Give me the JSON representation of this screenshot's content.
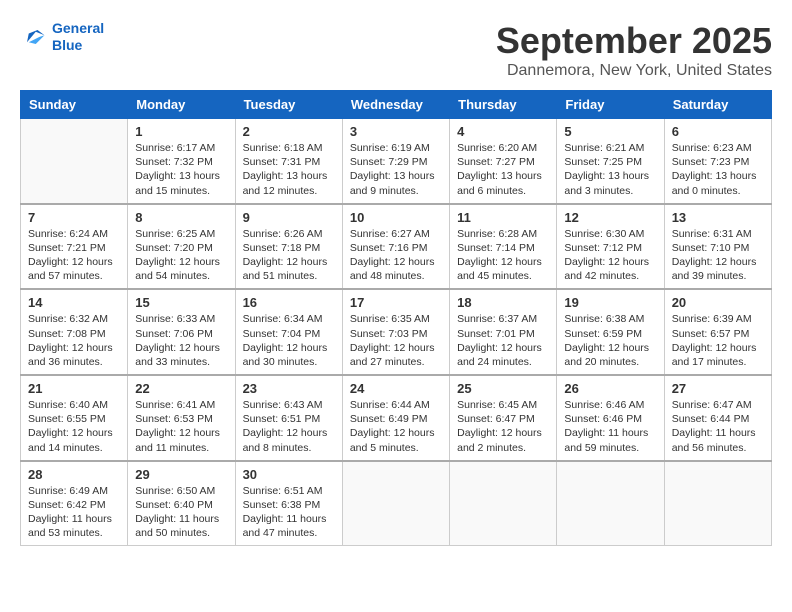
{
  "header": {
    "logo_line1": "General",
    "logo_line2": "Blue",
    "month": "September 2025",
    "location": "Dannemora, New York, United States"
  },
  "weekdays": [
    "Sunday",
    "Monday",
    "Tuesday",
    "Wednesday",
    "Thursday",
    "Friday",
    "Saturday"
  ],
  "weeks": [
    [
      {
        "day": "",
        "lines": []
      },
      {
        "day": "1",
        "lines": [
          "Sunrise: 6:17 AM",
          "Sunset: 7:32 PM",
          "Daylight: 13 hours",
          "and 15 minutes."
        ]
      },
      {
        "day": "2",
        "lines": [
          "Sunrise: 6:18 AM",
          "Sunset: 7:31 PM",
          "Daylight: 13 hours",
          "and 12 minutes."
        ]
      },
      {
        "day": "3",
        "lines": [
          "Sunrise: 6:19 AM",
          "Sunset: 7:29 PM",
          "Daylight: 13 hours",
          "and 9 minutes."
        ]
      },
      {
        "day": "4",
        "lines": [
          "Sunrise: 6:20 AM",
          "Sunset: 7:27 PM",
          "Daylight: 13 hours",
          "and 6 minutes."
        ]
      },
      {
        "day": "5",
        "lines": [
          "Sunrise: 6:21 AM",
          "Sunset: 7:25 PM",
          "Daylight: 13 hours",
          "and 3 minutes."
        ]
      },
      {
        "day": "6",
        "lines": [
          "Sunrise: 6:23 AM",
          "Sunset: 7:23 PM",
          "Daylight: 13 hours",
          "and 0 minutes."
        ]
      }
    ],
    [
      {
        "day": "7",
        "lines": [
          "Sunrise: 6:24 AM",
          "Sunset: 7:21 PM",
          "Daylight: 12 hours",
          "and 57 minutes."
        ]
      },
      {
        "day": "8",
        "lines": [
          "Sunrise: 6:25 AM",
          "Sunset: 7:20 PM",
          "Daylight: 12 hours",
          "and 54 minutes."
        ]
      },
      {
        "day": "9",
        "lines": [
          "Sunrise: 6:26 AM",
          "Sunset: 7:18 PM",
          "Daylight: 12 hours",
          "and 51 minutes."
        ]
      },
      {
        "day": "10",
        "lines": [
          "Sunrise: 6:27 AM",
          "Sunset: 7:16 PM",
          "Daylight: 12 hours",
          "and 48 minutes."
        ]
      },
      {
        "day": "11",
        "lines": [
          "Sunrise: 6:28 AM",
          "Sunset: 7:14 PM",
          "Daylight: 12 hours",
          "and 45 minutes."
        ]
      },
      {
        "day": "12",
        "lines": [
          "Sunrise: 6:30 AM",
          "Sunset: 7:12 PM",
          "Daylight: 12 hours",
          "and 42 minutes."
        ]
      },
      {
        "day": "13",
        "lines": [
          "Sunrise: 6:31 AM",
          "Sunset: 7:10 PM",
          "Daylight: 12 hours",
          "and 39 minutes."
        ]
      }
    ],
    [
      {
        "day": "14",
        "lines": [
          "Sunrise: 6:32 AM",
          "Sunset: 7:08 PM",
          "Daylight: 12 hours",
          "and 36 minutes."
        ]
      },
      {
        "day": "15",
        "lines": [
          "Sunrise: 6:33 AM",
          "Sunset: 7:06 PM",
          "Daylight: 12 hours",
          "and 33 minutes."
        ]
      },
      {
        "day": "16",
        "lines": [
          "Sunrise: 6:34 AM",
          "Sunset: 7:04 PM",
          "Daylight: 12 hours",
          "and 30 minutes."
        ]
      },
      {
        "day": "17",
        "lines": [
          "Sunrise: 6:35 AM",
          "Sunset: 7:03 PM",
          "Daylight: 12 hours",
          "and 27 minutes."
        ]
      },
      {
        "day": "18",
        "lines": [
          "Sunrise: 6:37 AM",
          "Sunset: 7:01 PM",
          "Daylight: 12 hours",
          "and 24 minutes."
        ]
      },
      {
        "day": "19",
        "lines": [
          "Sunrise: 6:38 AM",
          "Sunset: 6:59 PM",
          "Daylight: 12 hours",
          "and 20 minutes."
        ]
      },
      {
        "day": "20",
        "lines": [
          "Sunrise: 6:39 AM",
          "Sunset: 6:57 PM",
          "Daylight: 12 hours",
          "and 17 minutes."
        ]
      }
    ],
    [
      {
        "day": "21",
        "lines": [
          "Sunrise: 6:40 AM",
          "Sunset: 6:55 PM",
          "Daylight: 12 hours",
          "and 14 minutes."
        ]
      },
      {
        "day": "22",
        "lines": [
          "Sunrise: 6:41 AM",
          "Sunset: 6:53 PM",
          "Daylight: 12 hours",
          "and 11 minutes."
        ]
      },
      {
        "day": "23",
        "lines": [
          "Sunrise: 6:43 AM",
          "Sunset: 6:51 PM",
          "Daylight: 12 hours",
          "and 8 minutes."
        ]
      },
      {
        "day": "24",
        "lines": [
          "Sunrise: 6:44 AM",
          "Sunset: 6:49 PM",
          "Daylight: 12 hours",
          "and 5 minutes."
        ]
      },
      {
        "day": "25",
        "lines": [
          "Sunrise: 6:45 AM",
          "Sunset: 6:47 PM",
          "Daylight: 12 hours",
          "and 2 minutes."
        ]
      },
      {
        "day": "26",
        "lines": [
          "Sunrise: 6:46 AM",
          "Sunset: 6:46 PM",
          "Daylight: 11 hours",
          "and 59 minutes."
        ]
      },
      {
        "day": "27",
        "lines": [
          "Sunrise: 6:47 AM",
          "Sunset: 6:44 PM",
          "Daylight: 11 hours",
          "and 56 minutes."
        ]
      }
    ],
    [
      {
        "day": "28",
        "lines": [
          "Sunrise: 6:49 AM",
          "Sunset: 6:42 PM",
          "Daylight: 11 hours",
          "and 53 minutes."
        ]
      },
      {
        "day": "29",
        "lines": [
          "Sunrise: 6:50 AM",
          "Sunset: 6:40 PM",
          "Daylight: 11 hours",
          "and 50 minutes."
        ]
      },
      {
        "day": "30",
        "lines": [
          "Sunrise: 6:51 AM",
          "Sunset: 6:38 PM",
          "Daylight: 11 hours",
          "and 47 minutes."
        ]
      },
      {
        "day": "",
        "lines": []
      },
      {
        "day": "",
        "lines": []
      },
      {
        "day": "",
        "lines": []
      },
      {
        "day": "",
        "lines": []
      }
    ]
  ]
}
